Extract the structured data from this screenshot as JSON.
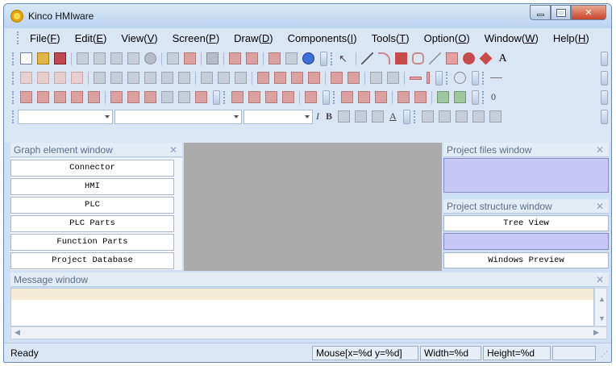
{
  "window": {
    "title": "Kinco HMIware"
  },
  "menu": [
    {
      "label": "File(",
      "key": "F",
      "close": ")"
    },
    {
      "label": "Edit(",
      "key": "E",
      "close": ")"
    },
    {
      "label": "View(",
      "key": "V",
      "close": ")"
    },
    {
      "label": "Screen(",
      "key": "P",
      "close": ")"
    },
    {
      "label": "Draw(",
      "key": "D",
      "close": ")"
    },
    {
      "label": "Components(",
      "key": "I",
      "close": ")"
    },
    {
      "label": "Tools(",
      "key": "T",
      "close": ")"
    },
    {
      "label": "Option(",
      "key": "O",
      "close": ")"
    },
    {
      "label": "Window(",
      "key": "W",
      "close": ")"
    },
    {
      "label": "Help(",
      "key": "H",
      "close": ")"
    }
  ],
  "toolbar": {
    "text_tool": "A",
    "row4_value": "0",
    "bold": "B",
    "italic": "I",
    "font_color": "A",
    "shape_icons": [
      "arrow-icon",
      "line-icon",
      "arc-icon",
      "rectangle-icon",
      "rounded-rect-icon",
      "polyline-icon",
      "polygon-icon",
      "ellipse-icon",
      "diamond-icon",
      "text-icon"
    ]
  },
  "graph_panel": {
    "title": "Graph element window",
    "items": [
      "Connector",
      "HMI",
      "PLC",
      "PLC Parts",
      "Function Parts",
      "Project Database"
    ]
  },
  "project_files": {
    "title": "Project files window"
  },
  "project_structure": {
    "title": "Project structure window",
    "tree_view": "Tree View",
    "windows_preview": "Windows Preview"
  },
  "message_window": {
    "title": "Message window"
  },
  "status": {
    "ready": "Ready",
    "mouse": "Mouse[x=%d  y=%d]",
    "width": "Width=%d",
    "height": "Height=%d"
  },
  "colors": {
    "workspace": "#ababab",
    "panel_fill": "#c8c8f8",
    "titlebar": "#bcd4ef"
  }
}
